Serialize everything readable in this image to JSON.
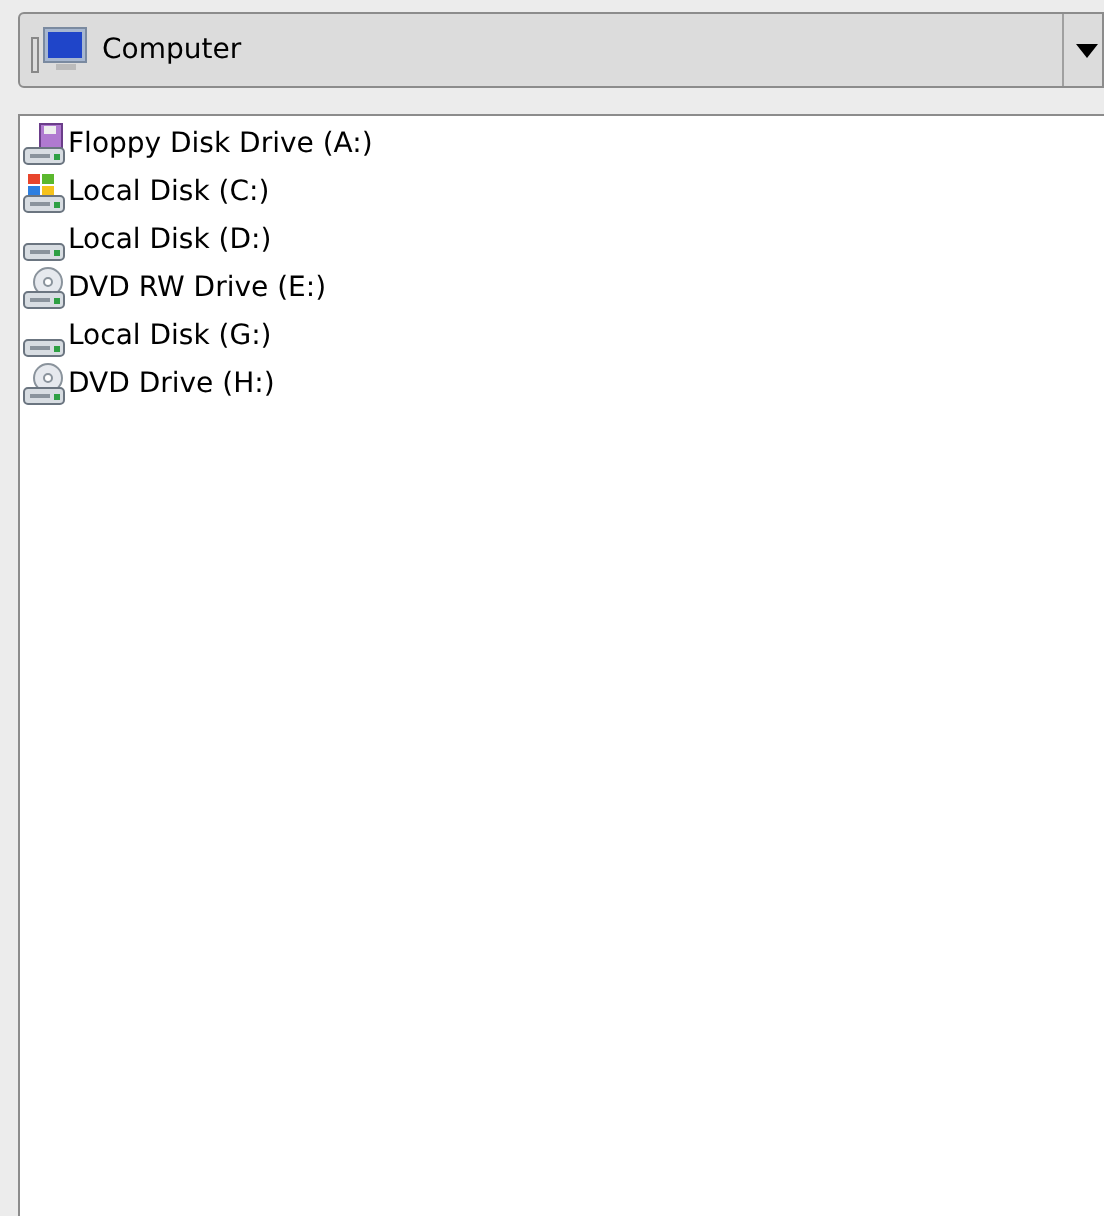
{
  "location": {
    "label": "Computer"
  },
  "drives": [
    {
      "label": "Floppy Disk Drive (A:)",
      "kind": "floppy"
    },
    {
      "label": "Local Disk (C:)",
      "kind": "system"
    },
    {
      "label": "Local Disk (D:)",
      "kind": "disk"
    },
    {
      "label": "DVD RW Drive (E:)",
      "kind": "optical"
    },
    {
      "label": "Local Disk (G:)",
      "kind": "disk"
    },
    {
      "label": "DVD Drive (H:)",
      "kind": "optical"
    }
  ]
}
